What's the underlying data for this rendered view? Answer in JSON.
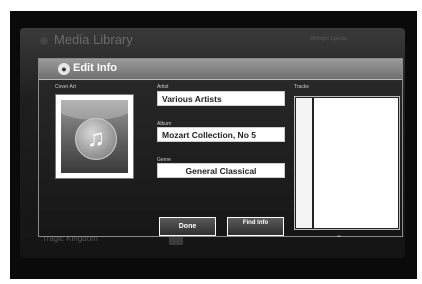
{
  "background": {
    "title": "Media Library",
    "right_text": "Midnight Special",
    "footer_text": "Tragic Kingdom"
  },
  "dialog": {
    "title": "Edit Info",
    "cover_label": "Cover Art",
    "artist_label": "Artist",
    "artist_value": "Various Artists",
    "album_label": "Album",
    "album_value": "Mozart Collection, No 5",
    "genre_label": "Genre",
    "genre_value": "General Classical",
    "done_label": "Done",
    "find_label": "Find Info",
    "tracks_label": "Tracks",
    "track_rows": 10
  },
  "icons": {
    "cover": "music-note-icon",
    "header": "edit-info-icon",
    "scroll": "chevron-down-icon"
  }
}
